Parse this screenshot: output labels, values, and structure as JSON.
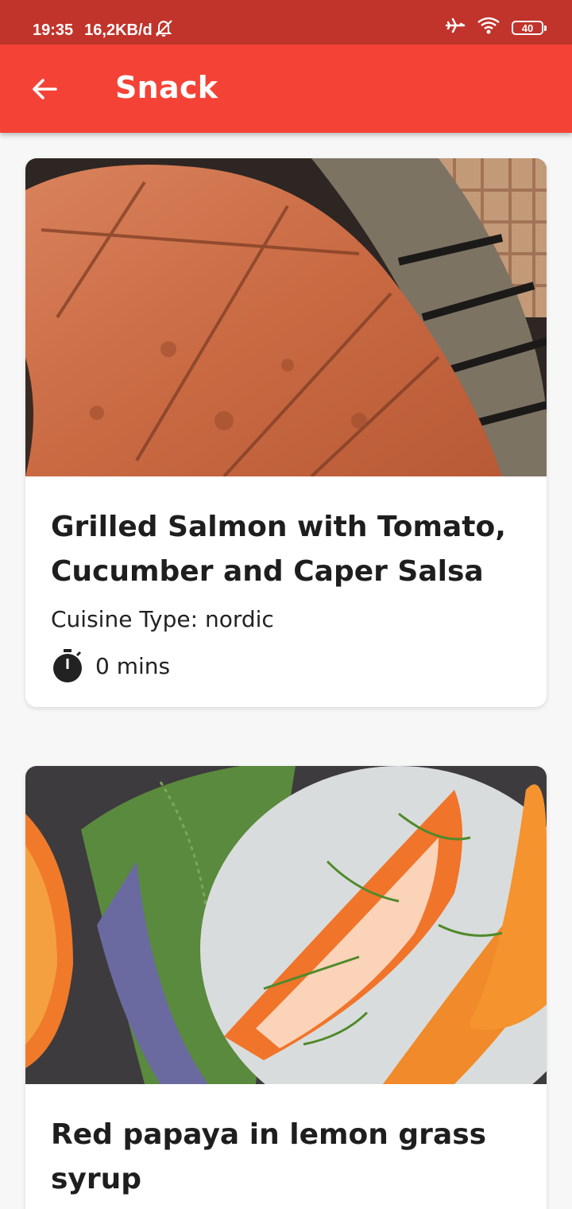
{
  "status_bar": {
    "time": "19:35",
    "network_speed": "16,2KB/d",
    "battery_level": "40",
    "icons": [
      "mute-icon",
      "airplane-icon",
      "wifi-icon",
      "battery-icon"
    ]
  },
  "app_bar": {
    "title": "Snack",
    "background_color": "#f44336",
    "back_icon": "arrow-back-icon"
  },
  "recipes": [
    {
      "title": "Grilled Salmon with Tomato, Cucumber and Caper Salsa",
      "cuisine_label": "Cuisine Type: nordic",
      "time": "0 mins",
      "image_icon": "grilled-salmon-photo"
    },
    {
      "title": "Red papaya in lemon grass syrup",
      "image_icon": "papaya-photo"
    }
  ]
}
